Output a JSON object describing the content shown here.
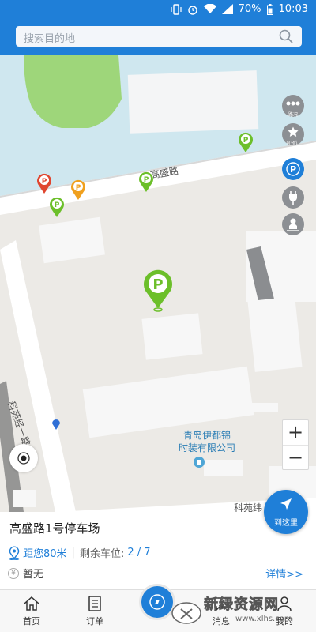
{
  "status_bar": {
    "battery": "70%",
    "time": "10:03"
  },
  "search": {
    "placeholder": "搜索目的地"
  },
  "map": {
    "road_gaosheng": "高盛路",
    "road_keyuan_1": "科苑经一路",
    "road_keyuan_bottom": "科苑纬",
    "poi_line1": "青岛伊都锦",
    "poi_line2": "时装有限公司",
    "side_buttons": [
      {
        "label": "路况",
        "icon": "traffic-icon"
      },
      {
        "label": "可预订",
        "icon": "star-icon"
      },
      {
        "label": "",
        "icon": "parking-icon"
      },
      {
        "label": "",
        "icon": "charging-icon"
      },
      {
        "label": "",
        "icon": "person-icon"
      }
    ],
    "zoom_in": "+",
    "zoom_out": "−",
    "navigate_label": "到这里"
  },
  "parking_lot": {
    "name": "高盛路1号停车场",
    "distance": "距您80米",
    "remaining_label": "剩余车位:",
    "spaces": "2 / 7",
    "price": "暂无",
    "price_symbol": "¥",
    "details_link": "详情>>"
  },
  "tabs": [
    {
      "label": "首页",
      "icon": "home-icon"
    },
    {
      "label": "订单",
      "icon": "orders-icon"
    },
    {
      "label": "消息",
      "icon": "message-icon"
    },
    {
      "label": "我的",
      "icon": "profile-icon"
    }
  ],
  "watermark": {
    "title": "新绿资源网",
    "url": "www.xlhs.com"
  },
  "colors": {
    "brand": "#1f7fd8",
    "pin_green": "#6cbf2a",
    "pin_red": "#e0452e",
    "pin_orange": "#f0a01e"
  }
}
